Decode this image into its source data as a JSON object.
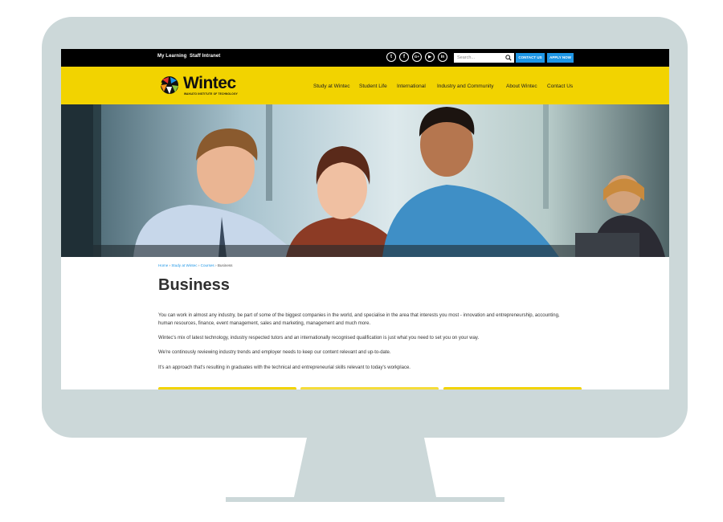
{
  "colors": {
    "accent_yellow": "#f2d300",
    "link_blue": "#1e96e6",
    "bezel": "#ccd8d9",
    "topbar": "#000000",
    "title_text": "#2f2f2f"
  },
  "topbar": {
    "links": [
      "My Learning",
      "Staff Intranet"
    ],
    "social_icons": [
      "twitter-icon",
      "facebook-icon",
      "google-plus-icon",
      "youtube-icon",
      "linkedin-icon"
    ],
    "social_glyphs": [
      "t",
      "f",
      "G+",
      "▶",
      "in"
    ],
    "search_placeholder": "Search...",
    "contact_button": "CONTACT US",
    "apply_button": "APPLY NOW"
  },
  "header": {
    "logo_text": "Wintec",
    "logo_subtext": "WAIKATO INSTITUTE OF TECHNOLOGY",
    "nav": [
      "Study at Wintec",
      "Student Life",
      "International",
      "Industry and Community",
      "About Wintec",
      "Contact Us"
    ]
  },
  "breadcrumb": {
    "items": [
      "Home",
      "Study at Wintec",
      "Courses"
    ],
    "separator": "›",
    "current": "Business"
  },
  "main": {
    "title": "Business",
    "paragraphs": [
      "You can work in almost any industry, be part of some of the biggest companies in the world, and specialise in the area that interests you most - innovation and entrepreneurship, accounting, human resources, finance, event management, sales and marketing, management and much more.",
      "Wintec's mix of latest technology, industry respected tutors and an internationally recognised qualification is just what you need to set you on your way.",
      "We're continously reviewing industry trends and employer needs to keep our content relevant and up-to-date.",
      "It's an approach that's resulting in graduates with the technical and entrepreneurial skills relevant to today's workplace."
    ]
  }
}
